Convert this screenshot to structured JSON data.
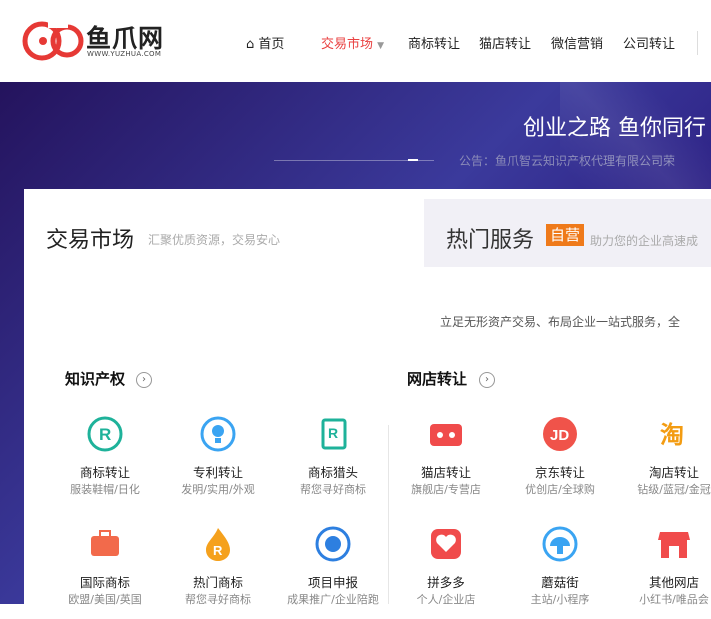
{
  "header": {
    "logo_cn": "鱼爪网",
    "logo_en": "WWW.YUZHUA.COM",
    "nav": [
      "首页",
      "交易市场",
      "商标转让",
      "猫店转让",
      "微信营销",
      "公司转让"
    ]
  },
  "banner": {
    "slogan": "创业之路 鱼你同行",
    "notice": "公告：鱼爪智云知识产权代理有限公司荣"
  },
  "tabs": [
    {
      "title": "交易市场",
      "sub": "汇聚优质资源，交易安心"
    },
    {
      "title": "热门服务",
      "badge": "自营",
      "sub": "助力您的企业高速成"
    }
  ],
  "description": "立足无形资产交易、布局企业一站式服务，全",
  "sections": [
    {
      "title": "知识产权",
      "items": [
        {
          "name": "商标转让",
          "sub": "服装鞋帽/日化",
          "icon": "trademark-transfer-icon"
        },
        {
          "name": "专利转让",
          "sub": "发明/实用/外观",
          "icon": "patent-transfer-icon"
        },
        {
          "name": "商标猎头",
          "sub": "帮您寻好商标",
          "icon": "trademark-hunter-icon"
        },
        {
          "name": "国际商标",
          "sub": "欧盟/美国/英国",
          "icon": "international-trademark-icon"
        },
        {
          "name": "热门商标",
          "sub": "帮您寻好商标",
          "icon": "hot-trademark-icon"
        },
        {
          "name": "项目申报",
          "sub": "成果推广/企业陪跑",
          "icon": "project-apply-icon"
        }
      ]
    },
    {
      "title": "网店转让",
      "items": [
        {
          "name": "猫店转让",
          "sub": "旗舰店/专营店",
          "icon": "tmall-icon"
        },
        {
          "name": "京东转让",
          "sub": "优创店/全球购",
          "icon": "jd-icon"
        },
        {
          "name": "淘店转让",
          "sub": "钻级/蓝冠/金冠",
          "icon": "taobao-icon"
        },
        {
          "name": "拼多多",
          "sub": "个人/企业店",
          "icon": "pinduoduo-icon"
        },
        {
          "name": "蘑菇街",
          "sub": "主站/小程序",
          "icon": "mogujie-icon"
        },
        {
          "name": "其他网店",
          "sub": "小红书/唯品会",
          "icon": "other-store-icon"
        }
      ]
    }
  ],
  "colors": {
    "accent": "#e94242",
    "badge": "#ef7a1a",
    "banner": "#2c1f82"
  }
}
